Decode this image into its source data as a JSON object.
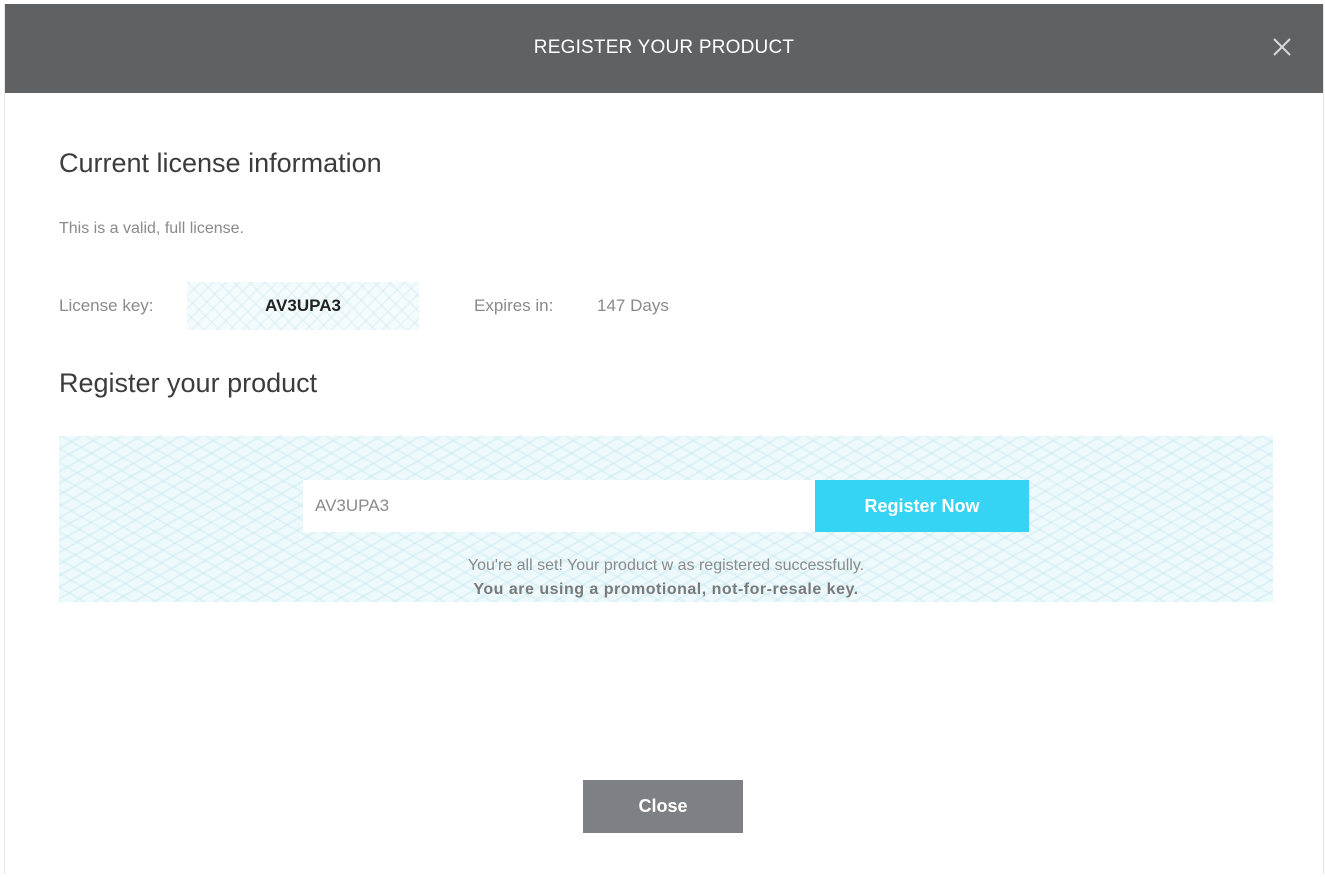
{
  "dialog": {
    "title": "REGISTER YOUR PRODUCT",
    "close_icon": "close-icon"
  },
  "license": {
    "heading": "Current license information",
    "status_text": "This is a valid, full license.",
    "key_label": "License key:",
    "key_value": "AV3UPA3",
    "expires_label": "Expires in:",
    "expires_value": "147 Days"
  },
  "register": {
    "heading": "Register your product",
    "input_value": "AV3UPA3",
    "button_label": "Register Now",
    "success_message": "You're all set! Your product w as registered successfully.",
    "promo_message": "You are using a promotional, not-for-resale key."
  },
  "footer": {
    "close_label": "Close"
  },
  "colors": {
    "titlebar": "#5f6163",
    "accent": "#35d3f4",
    "close_button": "#7d8084"
  }
}
